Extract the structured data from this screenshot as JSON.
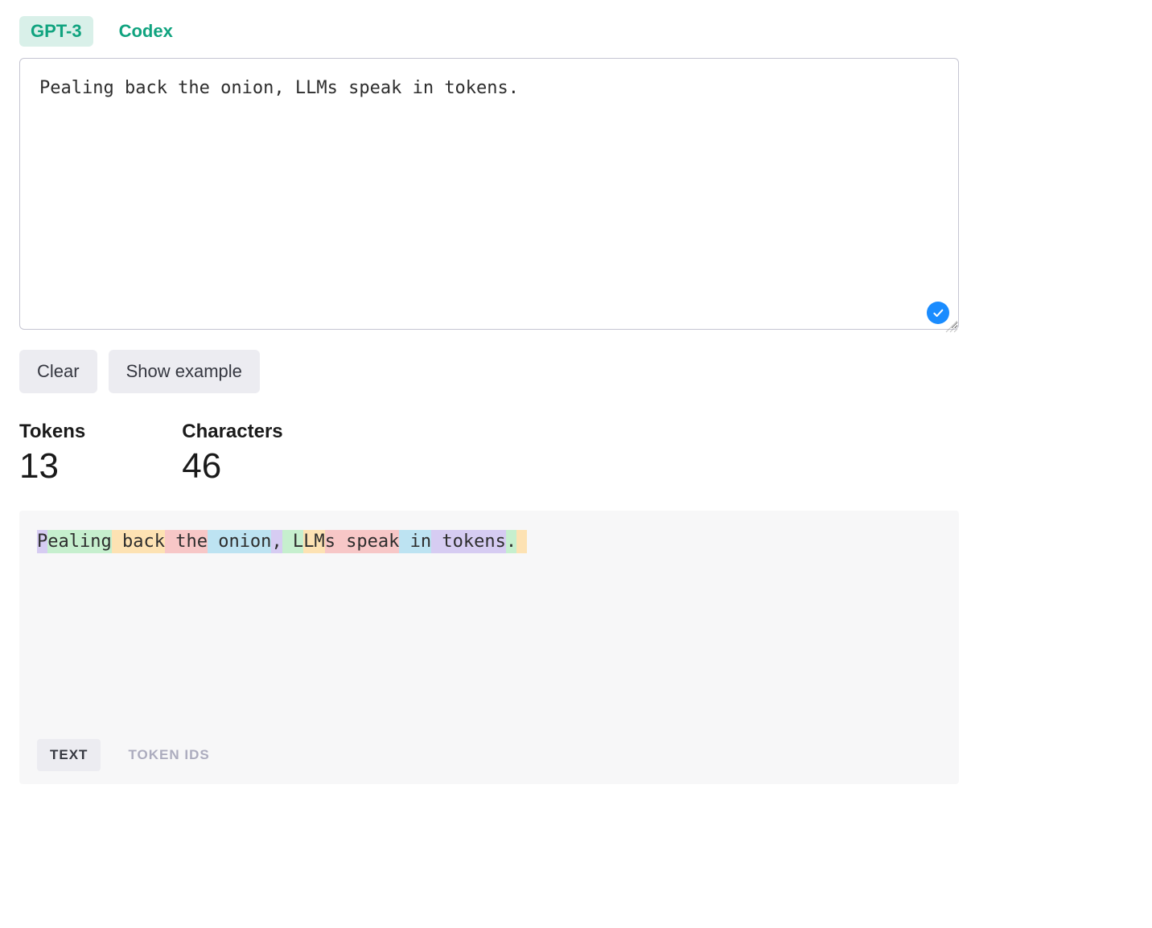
{
  "tabs": {
    "gpt3": "GPT-3",
    "codex": "Codex"
  },
  "input_text": "Pealing back the onion, LLMs speak in tokens.",
  "buttons": {
    "clear": "Clear",
    "show_example": "Show example"
  },
  "stats": {
    "tokens_label": "Tokens",
    "tokens_value": "13",
    "characters_label": "Characters",
    "characters_value": "46"
  },
  "token_colors": {
    "purple": "#d6ccf2",
    "green": "#c6efce",
    "orange": "#fde2b3",
    "red": "#f7c7c7",
    "blue": "#bde3f2"
  },
  "tokens": [
    {
      "text": "P",
      "color": "purple"
    },
    {
      "text": "ealing",
      "color": "green"
    },
    {
      "text": " back",
      "color": "orange"
    },
    {
      "text": " the",
      "color": "red"
    },
    {
      "text": " onion",
      "color": "blue"
    },
    {
      "text": ",",
      "color": "purple"
    },
    {
      "text": " L",
      "color": "green"
    },
    {
      "text": "LM",
      "color": "orange"
    },
    {
      "text": "s",
      "color": "red"
    },
    {
      "text": " speak",
      "color": "red"
    },
    {
      "text": " in",
      "color": "blue"
    },
    {
      "text": " tokens",
      "color": "purple"
    },
    {
      "text": ".",
      "color": "green"
    },
    {
      "text": " ",
      "color": "orange"
    }
  ],
  "view_tabs": {
    "text": "TEXT",
    "token_ids": "TOKEN IDS"
  }
}
